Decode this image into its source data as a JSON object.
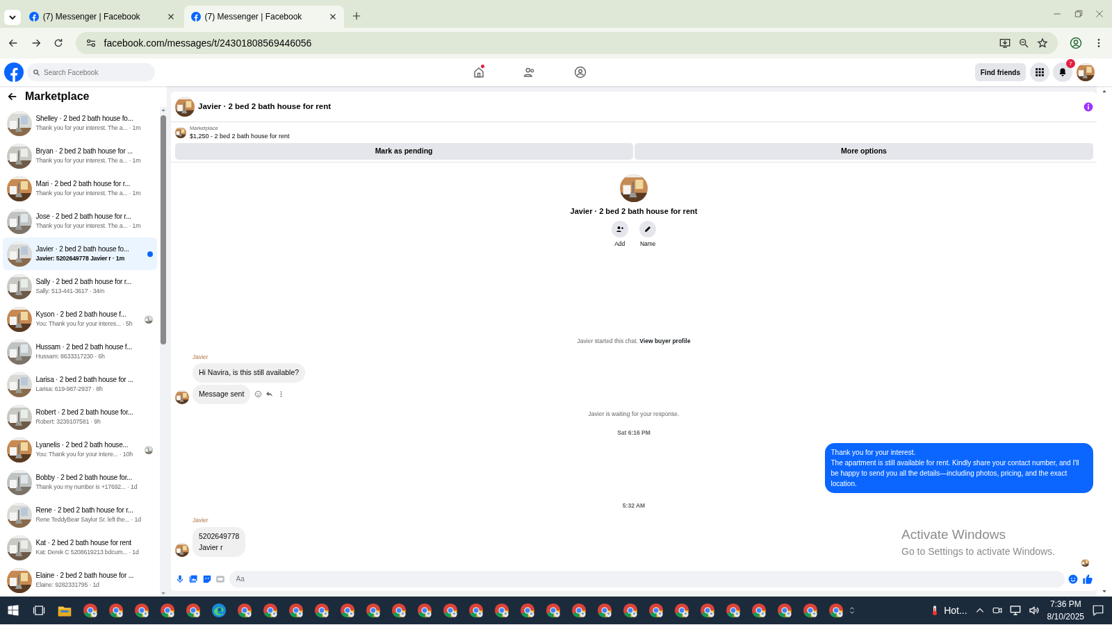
{
  "browser": {
    "tabs": [
      {
        "title": "(7) Messenger | Facebook",
        "selected": false
      },
      {
        "title": "(7) Messenger | Facebook",
        "selected": true
      }
    ],
    "url": "facebook.com/messages/t/24301808569446056"
  },
  "facebook_bar": {
    "search": {
      "placeholder": "Search Facebook"
    },
    "nav": [
      {
        "kind": "home",
        "selected": false,
        "dot": true
      },
      {
        "kind": "friends",
        "selected": false,
        "dot": false
      },
      {
        "kind": "groups",
        "selected": false,
        "dot": false
      }
    ],
    "find_friends": "Find friends",
    "notifications_badge": "7"
  },
  "sidebar": {
    "title": "Marketplace",
    "items": [
      {
        "title": "Shelley · 2 bed 2 bath house fo...",
        "preview": "Thank you for your interest. The a... · 1m",
        "selected": false,
        "unread": false,
        "seen_avatar": false
      },
      {
        "title": "Bryan · 2 bed 2 bath house for ...",
        "preview": "Thank you for your interest. The a... · 1m",
        "selected": false,
        "unread": false,
        "seen_avatar": false
      },
      {
        "title": "Mari · 2 bed 2 bath house for r...",
        "preview": "Thank you for your interest. The a... · 1m",
        "selected": false,
        "unread": false,
        "seen_avatar": false
      },
      {
        "title": "Jose · 2 bed 2 bath house for r...",
        "preview": "Thank you for your interest. The a... · 1m",
        "selected": false,
        "unread": false,
        "seen_avatar": false
      },
      {
        "title": "Javier · 2 bed 2 bath house fo...",
        "preview": "Javier: 5202649778 Javier r · 1m",
        "selected": true,
        "unread": true,
        "seen_avatar": false
      },
      {
        "title": "Sally · 2 bed 2 bath house for r...",
        "preview": "Sally: 513-441-3617 · 34m",
        "selected": false,
        "unread": false,
        "seen_avatar": false
      },
      {
        "title": "Kyson · 2 bed 2 bath house f...",
        "preview": "You: Thank you for your interes... · 5h",
        "selected": false,
        "unread": false,
        "seen_avatar": true
      },
      {
        "title": "Hussam · 2 bed 2 bath house f...",
        "preview": "Hussam: 8633317230 · 6h",
        "selected": false,
        "unread": false,
        "seen_avatar": false
      },
      {
        "title": "Larisa · 2 bed 2 bath house for ...",
        "preview": "Larisa: 619-987-2937 · 8h",
        "selected": false,
        "unread": false,
        "seen_avatar": false
      },
      {
        "title": "Robert · 2 bed 2 bath house for...",
        "preview": "Robert: 3239107581 · 9h",
        "selected": false,
        "unread": false,
        "seen_avatar": false
      },
      {
        "title": "Lyanelis · 2 bed 2 bath house...",
        "preview": "You: Thank you for your intere... · 10h",
        "selected": false,
        "unread": false,
        "seen_avatar": true
      },
      {
        "title": "Bobby · 2 bed 2 bath house for...",
        "preview": "Thank you my number is +17692... · 1d",
        "selected": false,
        "unread": false,
        "seen_avatar": false
      },
      {
        "title": "Rene · 2 bed 2 bath house for r...",
        "preview": "Rene TeddyBear Saylor Sr. left the... · 1d",
        "selected": false,
        "unread": false,
        "seen_avatar": false
      },
      {
        "title": "Kat · 2 bed 2 bath house for rent",
        "preview": "Kat: Derek C 5208619213 bdcum... · 1d",
        "selected": false,
        "unread": false,
        "seen_avatar": false
      },
      {
        "title": "Elaine · 2 bed 2 bath house for ...",
        "preview": "Elaine: 9282331795 · 1d",
        "selected": false,
        "unread": false,
        "seen_avatar": false
      }
    ]
  },
  "chat": {
    "title": "Javier · 2 bed 2 bath house for rent",
    "listing": {
      "label": "Marketplace",
      "text": "$1,250 - 2 bed 2 bath house for rent",
      "buttons": [
        "Mark as pending",
        "More options"
      ]
    },
    "profile": {
      "name": "Javier · 2 bed 2 bath house for rent",
      "actions": [
        {
          "kind": "add",
          "label": "Add"
        },
        {
          "kind": "name",
          "label": "Name"
        }
      ]
    },
    "messages": [
      {
        "kind": "notice",
        "text": "Javier started this chat.",
        "link": "View buyer profile"
      },
      {
        "kind": "incoming",
        "sender": "Javier",
        "bubbles": [
          {
            "text": "Hi Navira, is this still available?",
            "hover_actions": false
          },
          {
            "text": "Message sent",
            "hover_actions": true
          }
        ]
      },
      {
        "kind": "notice",
        "text": "Javier is waiting for your response."
      },
      {
        "kind": "time",
        "text": "Sat 6:16 PM"
      },
      {
        "kind": "outgoing",
        "lines": [
          "Thank you for your interest.",
          "The apartment is still available for rent. Kindly share your contact number, and I'll be happy to send you all the details—including photos, pricing, and the exact location."
        ]
      },
      {
        "kind": "time",
        "text": "5:32 AM"
      },
      {
        "kind": "incoming",
        "sender": "Javier",
        "bubbles": [
          {
            "text": "5202649778\nJavier r",
            "hover_actions": false
          }
        ]
      }
    ],
    "composer": {
      "placeholder": "Aa"
    }
  },
  "activation_notice": {
    "title": "Activate Windows",
    "text": "Go to Settings to activate Windows."
  },
  "taskbar": {
    "apps": [
      {
        "kind": "explorer"
      },
      {
        "kind": "chrome"
      },
      {
        "kind": "chrome"
      },
      {
        "kind": "chrome"
      },
      {
        "kind": "chrome"
      },
      {
        "kind": "chrome"
      },
      {
        "kind": "edge"
      },
      {
        "kind": "chrome"
      },
      {
        "kind": "chrome"
      },
      {
        "kind": "chrome"
      },
      {
        "kind": "chrome"
      },
      {
        "kind": "chrome"
      },
      {
        "kind": "chrome"
      },
      {
        "kind": "chrome"
      },
      {
        "kind": "chrome"
      },
      {
        "kind": "chrome"
      },
      {
        "kind": "chrome"
      },
      {
        "kind": "chrome"
      },
      {
        "kind": "chrome"
      },
      {
        "kind": "chrome"
      },
      {
        "kind": "chrome"
      },
      {
        "kind": "chrome"
      },
      {
        "kind": "chrome"
      },
      {
        "kind": "chrome"
      },
      {
        "kind": "chrome"
      },
      {
        "kind": "chrome"
      },
      {
        "kind": "chrome"
      },
      {
        "kind": "chrome"
      },
      {
        "kind": "chrome"
      },
      {
        "kind": "chrome"
      },
      {
        "kind": "chrome"
      }
    ],
    "weather": "Hot...",
    "time": "7:36 PM",
    "date": "8/10/2025"
  }
}
